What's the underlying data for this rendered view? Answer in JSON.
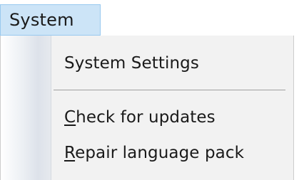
{
  "menubar": {
    "label": "System"
  },
  "menu": {
    "items": [
      {
        "label": "System Settings"
      },
      {
        "mnemonic": "C",
        "rest": "heck for updates"
      },
      {
        "mnemonic": "R",
        "rest": "epair language pack"
      }
    ]
  }
}
